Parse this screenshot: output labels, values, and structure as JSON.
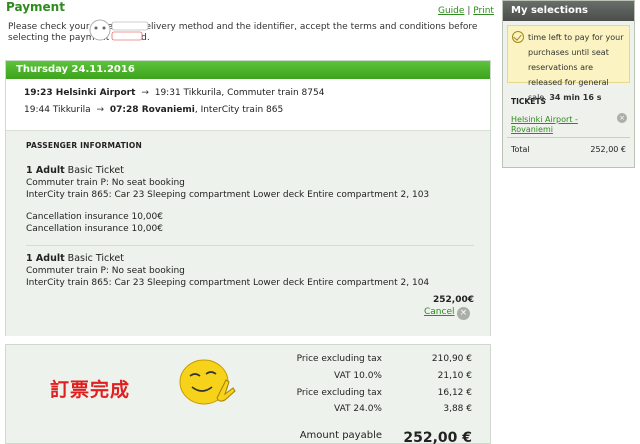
{
  "page": {
    "title": "Payment",
    "links": {
      "guide": "Guide",
      "separator": "|",
      "print": "Print"
    },
    "intro": "Please check your order, the delivery method and the identifier, accept the terms and conditions before selecting the payment method."
  },
  "trip": {
    "date": "Thursday 24.11.2016",
    "legs": [
      {
        "dep_time": "19:23",
        "from": "Helsinki Airport",
        "arrow": "→",
        "arr_time": "19:31",
        "to": "Tikkurila",
        "train": "Commuter train 8754",
        "bold": "dep"
      },
      {
        "dep_time": "19:44",
        "from": "Tikkurila",
        "arrow": "→",
        "arr_time": "07:28",
        "to": "Rovaniemi",
        "train": "InterCity train 865",
        "bold": "arr"
      }
    ],
    "passenger_title": "PASSENGER INFORMATION",
    "passengers": [
      {
        "count": "1 Adult",
        "ticket_type": "Basic Ticket",
        "line1": "Commuter train P: No seat booking",
        "line2": "InterCity train 865: Car 23 Sleeping compartment Lower deck Entire compartment 2, 103",
        "line3": "Cancellation insurance 10,00€",
        "line4": "Cancellation insurance 10,00€"
      },
      {
        "count": "1 Adult",
        "ticket_type": "Basic Ticket",
        "line1": "Commuter train P: No seat booking",
        "line2": "InterCity train 865: Car 23 Sleeping compartment Lower deck Entire compartment 2, 104"
      }
    ],
    "price": "252,00€",
    "cancel_label": "Cancel",
    "cancel_icon": "×"
  },
  "summary": {
    "overlay_text": "訂票完成",
    "rows": [
      {
        "label": "Price excluding tax",
        "value": "210,90 €"
      },
      {
        "label": "VAT 10.0%",
        "value": "21,10 €"
      },
      {
        "label": "Price excluding tax",
        "value": "16,12 €"
      },
      {
        "label": "VAT 24.0%",
        "value": "3,88 €"
      }
    ],
    "payable_label": "Amount payable",
    "payable_value": "252,00 €"
  },
  "selections": {
    "title": "My selections",
    "timer_text": "time left to pay for your purchases until seat reservations are released for general sale.",
    "timer_value": "34 min 16 s",
    "tickets_title": "TICKETS",
    "ticket_link": "Helsinki Airport - Rovaniemi",
    "remove_icon": "×",
    "total_label": "Total",
    "total_value": "252,00 €"
  },
  "colors": {
    "accent": "#3ea21e",
    "link": "#2e8b1e",
    "timer_bg": "#fbf3c2",
    "overlay_red": "#e02020",
    "smiley": "#f7d21a"
  }
}
